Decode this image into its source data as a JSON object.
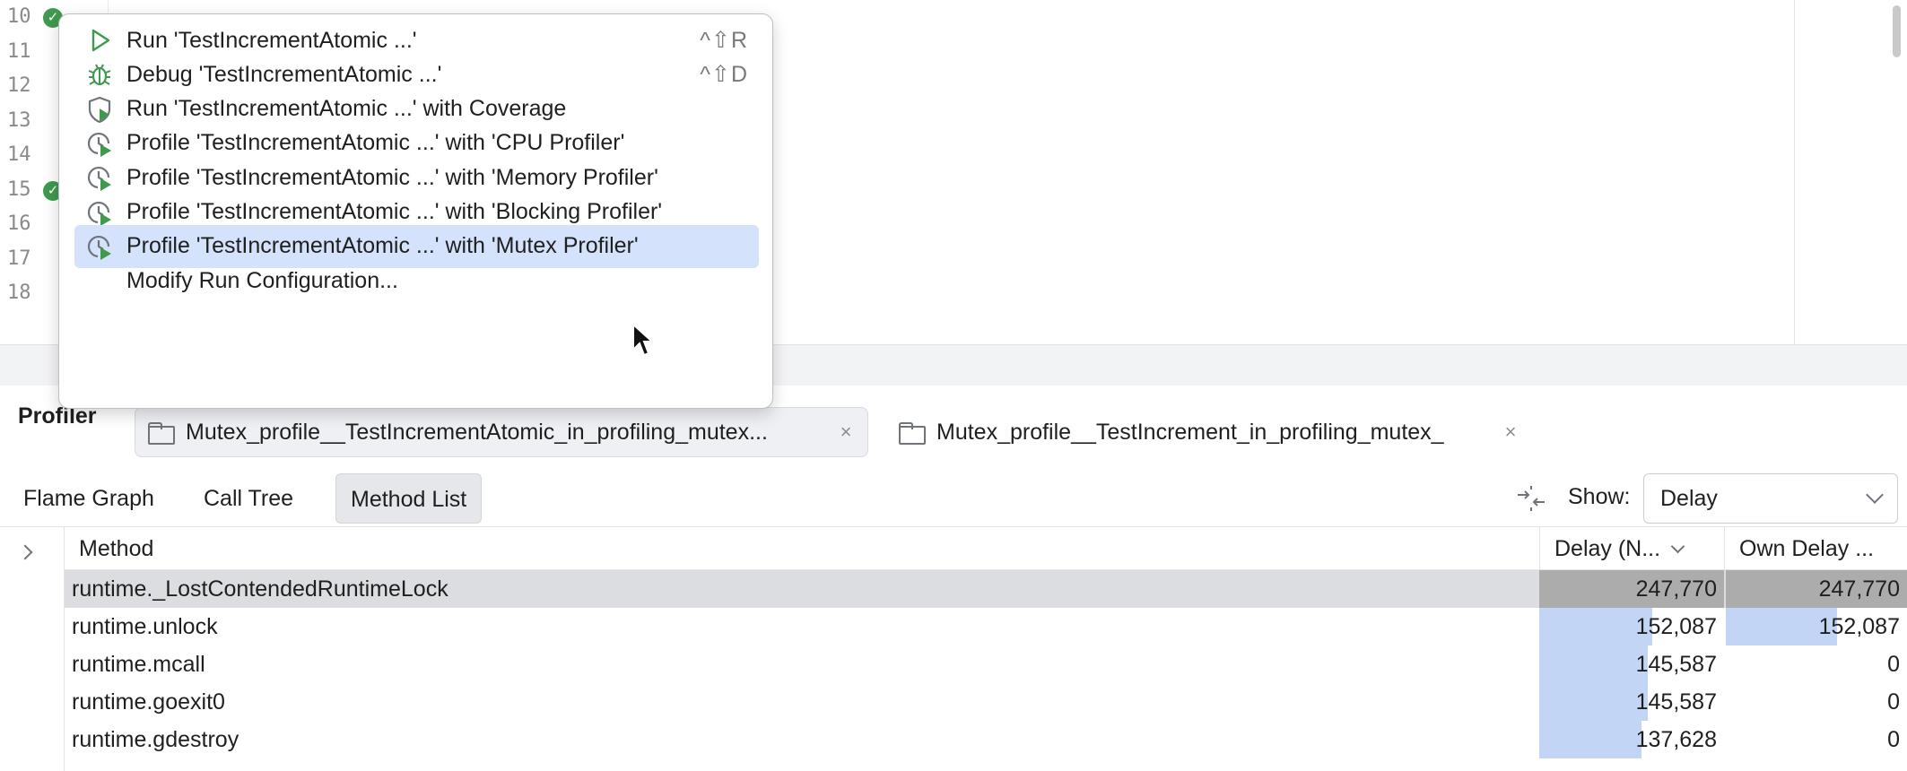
{
  "editor": {
    "line_numbers": [
      "10",
      "11",
      "12",
      "13",
      "14",
      "15",
      "16",
      "17",
      "18"
    ],
    "run_markers_on_lines": [
      "10",
      "15"
    ]
  },
  "popup_menu": {
    "items": [
      {
        "label": "Run 'TestIncrementAtomic ...'",
        "shortcut": "^⇧R",
        "icon": "run-icon"
      },
      {
        "label": "Debug 'TestIncrementAtomic ...'",
        "shortcut": "^⇧D",
        "icon": "debug-icon"
      },
      {
        "label": "Run 'TestIncrementAtomic ...' with Coverage",
        "shortcut": "",
        "icon": "coverage-icon"
      },
      {
        "label": "Profile 'TestIncrementAtomic ...' with 'CPU Profiler'",
        "shortcut": "",
        "icon": "profiler-icon"
      },
      {
        "label": "Profile 'TestIncrementAtomic ...' with 'Memory Profiler'",
        "shortcut": "",
        "icon": "profiler-icon"
      },
      {
        "label": "Profile 'TestIncrementAtomic ...' with 'Blocking Profiler'",
        "shortcut": "",
        "icon": "profiler-icon"
      },
      {
        "label": "Profile 'TestIncrementAtomic ...' with 'Mutex Profiler'",
        "shortcut": "",
        "icon": "profiler-icon",
        "highlighted": true
      },
      {
        "label": "Modify Run Configuration...",
        "shortcut": "",
        "icon": ""
      }
    ]
  },
  "profiler": {
    "title": "Profiler",
    "tabs": [
      {
        "label": "Mutex_profile__TestIncrementAtomic_in_profiling_mutex...",
        "active": true
      },
      {
        "label": "Mutex_profile__TestIncrement_in_profiling_mutex_",
        "active": false
      }
    ],
    "views": [
      "Flame Graph",
      "Call Tree",
      "Method List"
    ],
    "selected_view": "Method List",
    "show_label": "Show:",
    "show_value": "Delay",
    "columns": {
      "method": "Method",
      "delay": "Delay (N...",
      "own_delay": "Own Delay ..."
    },
    "rows": [
      {
        "method": "runtime._LostContendedRuntimeLock",
        "delay": "247,770",
        "own_delay": "247,770",
        "delay_fraction": 1.0,
        "own_fraction": 1.0,
        "highlighted": true
      },
      {
        "method": "runtime.unlock",
        "delay": "152,087",
        "own_delay": "152,087",
        "delay_fraction": 0.614,
        "own_fraction": 0.614
      },
      {
        "method": "runtime.mcall",
        "delay": "145,587",
        "own_delay": "0",
        "delay_fraction": 0.588,
        "own_fraction": 0
      },
      {
        "method": "runtime.goexit0",
        "delay": "145,587",
        "own_delay": "0",
        "delay_fraction": 0.588,
        "own_fraction": 0
      },
      {
        "method": "runtime.gdestroy",
        "delay": "137,628",
        "own_delay": "0",
        "delay_fraction": 0.555,
        "own_fraction": 0
      }
    ]
  },
  "colors": {
    "menu_highlight": "#d4e2fc",
    "bar_fill": "#c3d5f4",
    "row_highlight": "#dcdde0",
    "run_green": "#3f9a4e"
  }
}
